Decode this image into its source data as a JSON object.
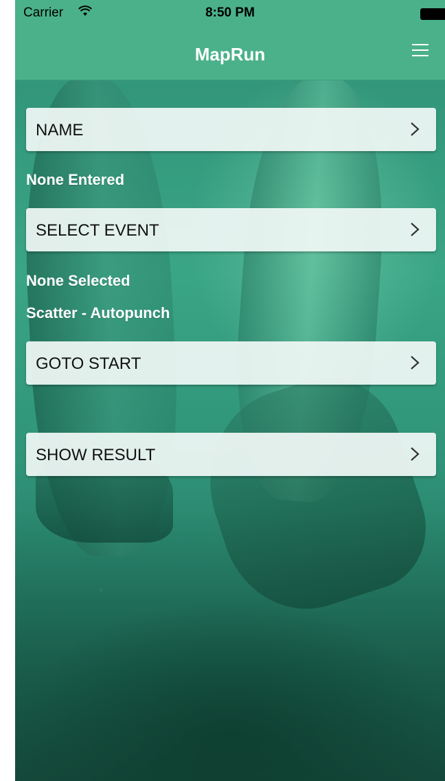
{
  "status_bar": {
    "carrier": "Carrier",
    "time": "8:50 PM",
    "wifi_icon": "wifi-icon",
    "battery_icon": "battery-icon"
  },
  "nav_bar": {
    "title": "MapRun",
    "menu_icon": "hamburger-menu-icon"
  },
  "main": {
    "name_button": {
      "label": "NAME",
      "icon": "chevron-right-icon"
    },
    "name_value": "None Entered",
    "event_button": {
      "label": "SELECT EVENT",
      "icon": "chevron-right-icon"
    },
    "event_value": "None Selected",
    "event_mode": "Scatter - Autopunch",
    "start_button": {
      "label": "GOTO START",
      "icon": "chevron-right-icon"
    },
    "result_button": {
      "label": "SHOW RESULT",
      "icon": "chevron-right-icon"
    }
  },
  "colors": {
    "bar": "#4bb18b",
    "background": "#2f9a7c",
    "button": "#f0f8f5"
  }
}
